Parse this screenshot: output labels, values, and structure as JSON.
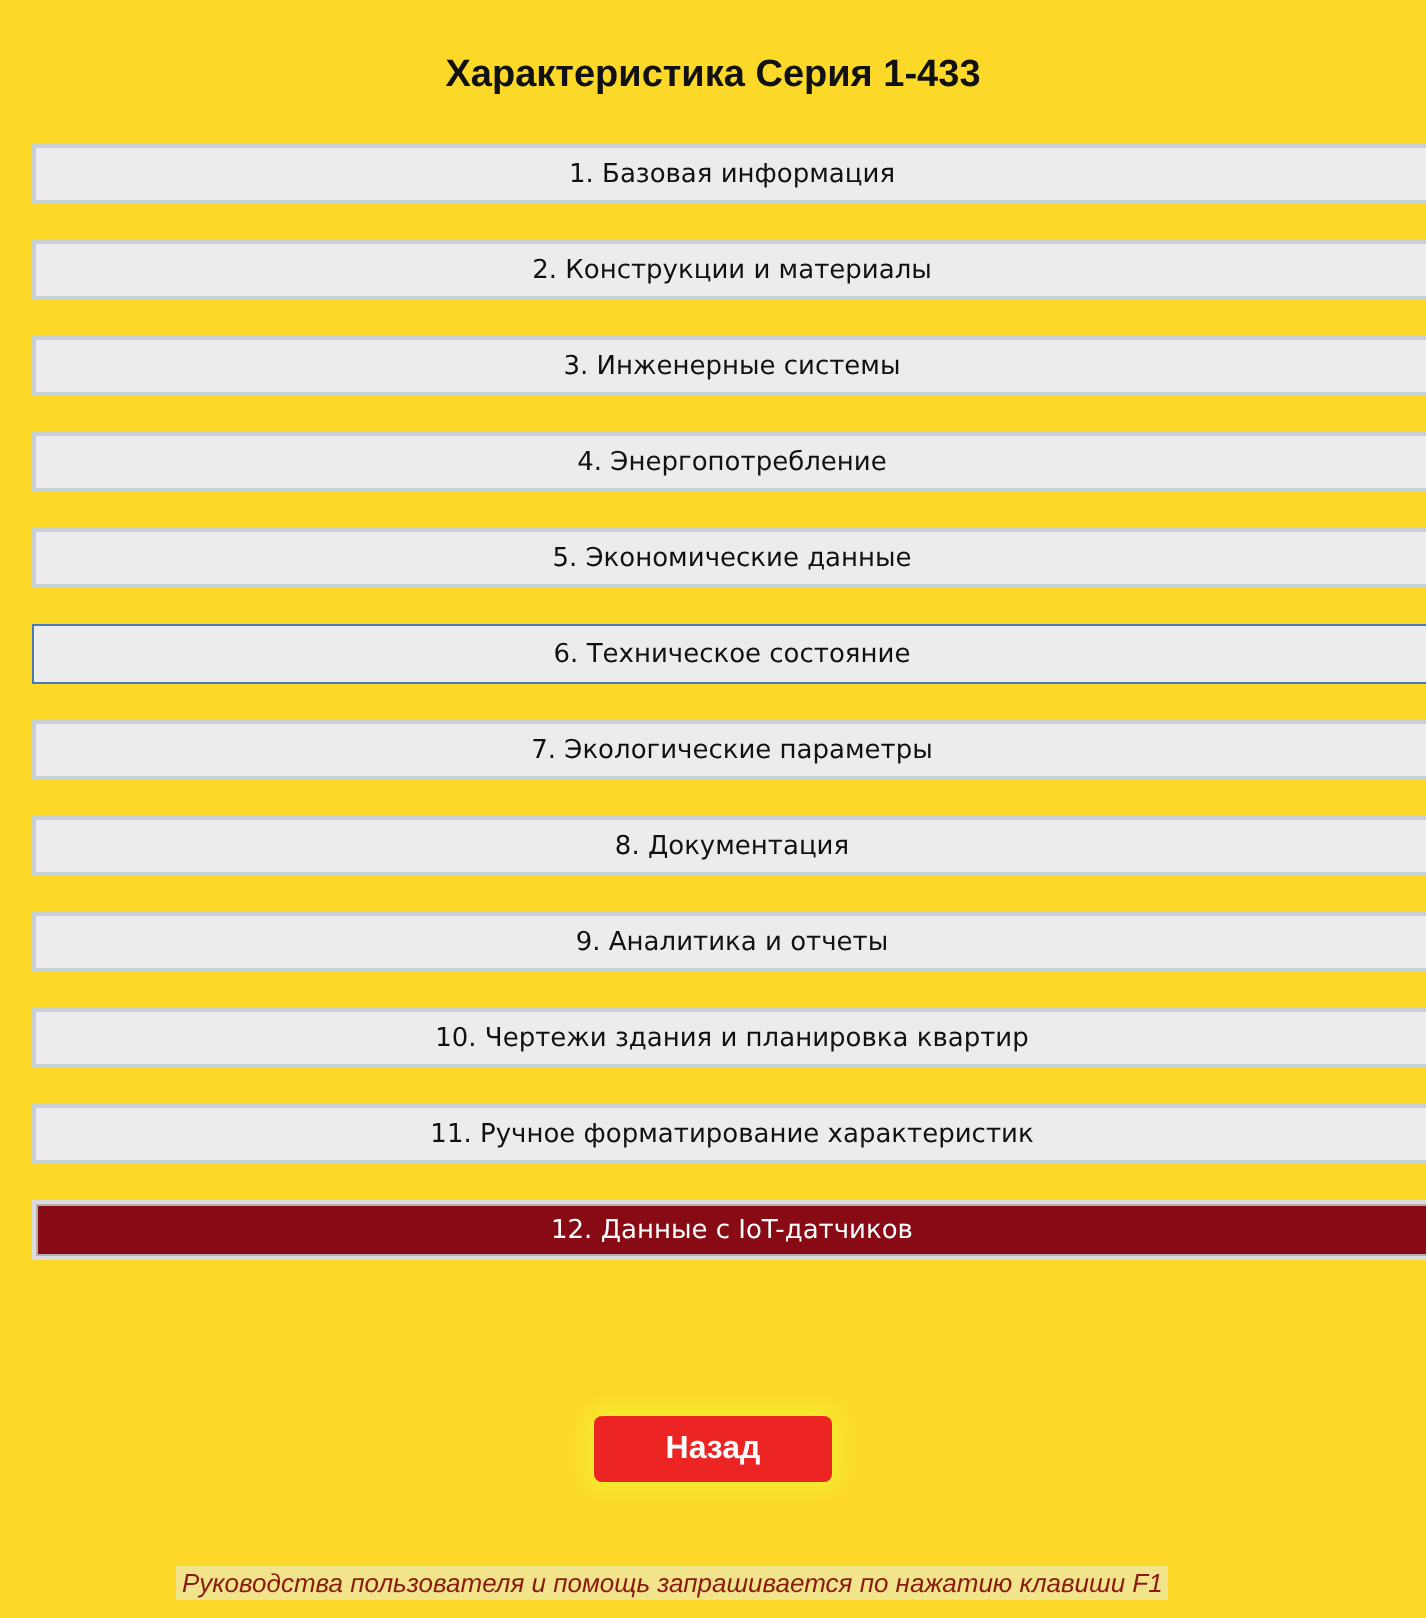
{
  "title": "Характеристика Серия 1-433",
  "sections": [
    {
      "label": "1. Базовая информация",
      "selected": false,
      "focused": false
    },
    {
      "label": "2. Конструкции и материалы",
      "selected": false,
      "focused": false
    },
    {
      "label": "3. Инженерные системы",
      "selected": false,
      "focused": false
    },
    {
      "label": "4. Энергопотребление",
      "selected": false,
      "focused": false
    },
    {
      "label": "5. Экономические данные",
      "selected": false,
      "focused": false
    },
    {
      "label": "6. Техническое состояние",
      "selected": false,
      "focused": true
    },
    {
      "label": "7. Экологические параметры",
      "selected": false,
      "focused": false
    },
    {
      "label": "8. Документация",
      "selected": false,
      "focused": false
    },
    {
      "label": "9. Аналитика и отчеты",
      "selected": false,
      "focused": false
    },
    {
      "label": "10. Чертежи здания и планировка квартир",
      "selected": false,
      "focused": false
    },
    {
      "label": "11. Ручное форматирование характеристик",
      "selected": false,
      "focused": false
    },
    {
      "label": "12. Данные с IoT-датчиков",
      "selected": true,
      "focused": false
    }
  ],
  "back_button": "Назад",
  "help_text": "Руководства пользователя и помощь запрашивается по нажатию клавиши F1"
}
